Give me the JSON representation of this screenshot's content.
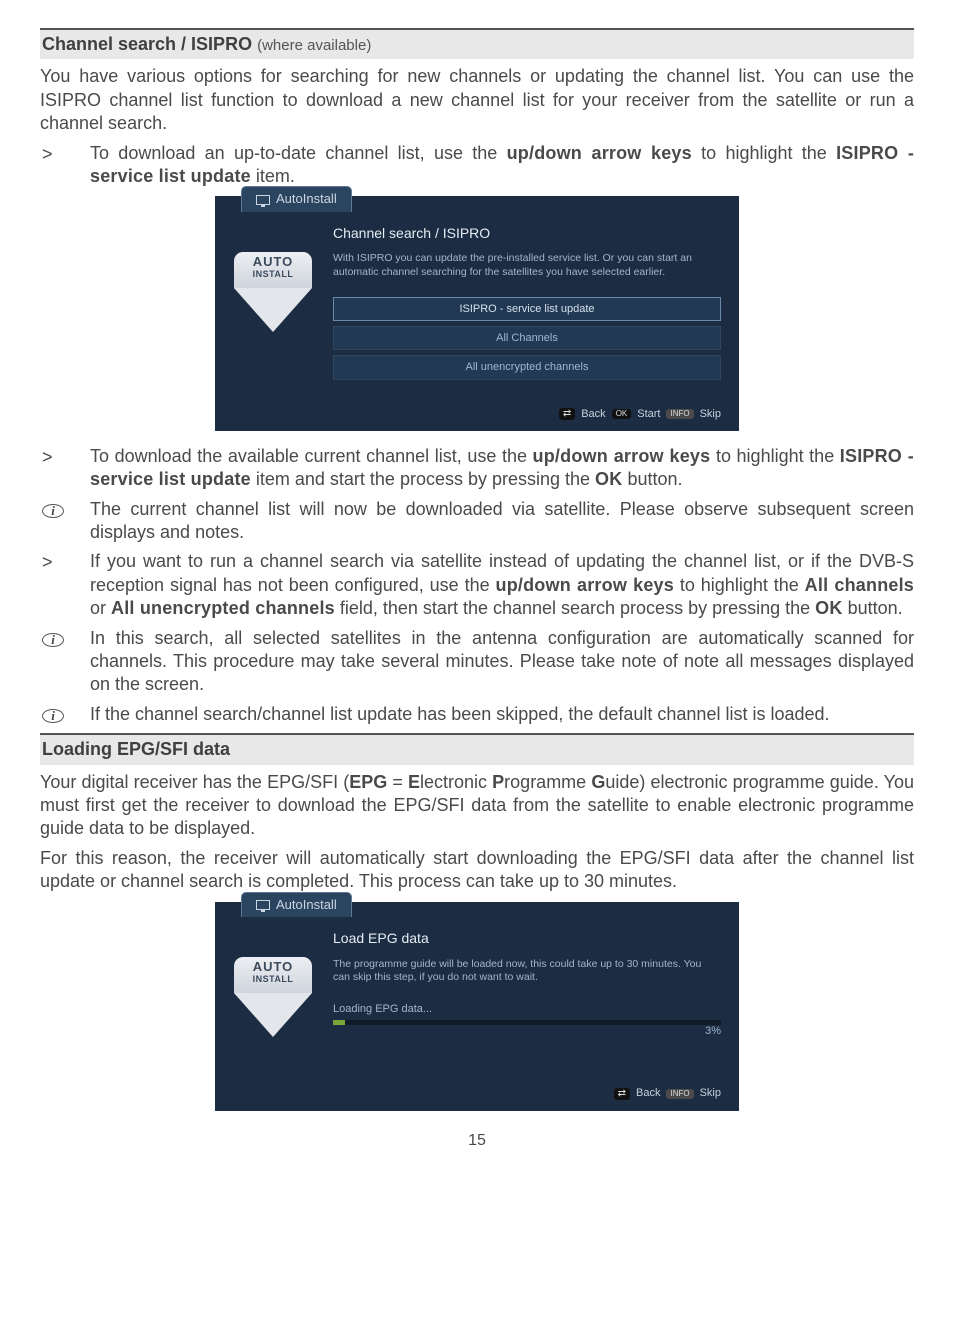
{
  "headings": {
    "section1_bold": "Channel search / ISIPRO",
    "section1_paren": "(where available)",
    "section2": "Loading EPG/SFI data"
  },
  "body": {
    "p1": "You have various options for searching for new channels or updating the channel list. You can use the ISIPRO channel list function to download a new channel list for your receiver from the satellite or run a channel search.",
    "b1a": "To download an up-to-date channel list, use the ",
    "b1_bold1": "up/down arrow keys",
    "b1b": " to highlight the ",
    "b1_bold2": "ISIPRO - service list update",
    "b1c": " item.",
    "b2a": "To download the available current channel list, use the ",
    "b2_bold1": "up/down arrow keys",
    "b2b": " to highlight the ",
    "b2_bold2": "ISIPRO - service list update",
    "b2c": " item and start the process by pressing the ",
    "b2_bold3": "OK",
    "b2d": " button.",
    "i1": "The current channel list will now be downloaded via satellite. Please observe subsequent screen displays and notes.",
    "b3a": "If you want to run a channel search via satellite instead of updating the channel list, or if the DVB-S reception signal has not been configured, use the ",
    "b3_bold1": "up/down arrow keys",
    "b3b": " to highlight the ",
    "b3_bold2": "All channels",
    "b3c": " or ",
    "b3_bold3": "All unencrypted channels",
    "b3d": " field, then start the channel search process by pressing the ",
    "b3_bold4": "OK",
    "b3e": " button.",
    "i2": "In this search, all selected satellites in the antenna configuration are automatically scanned for channels. This procedure may take several minutes. Please take note of note all messages displayed on the screen.",
    "i3": "If the channel search/channel list update has been skipped, the default channel list is loaded.",
    "p2a": "Your digital receiver has the EPG/SFI (",
    "p2_b1": "EPG",
    "p2b": " = ",
    "p2_b2": "E",
    "p2c": "lectronic ",
    "p2_b3": "P",
    "p2d": "rogramme ",
    "p2_b4": "G",
    "p2e": "uide) electronic programme guide. You must first get the receiver to download the EPG/SFI data from the satellite to enable electronic programme guide data to be displayed.",
    "p3": "For this reason, the receiver will automatically start downloading the EPG/SFI data after the channel list update or channel search is completed. This process can take up to 30 minutes."
  },
  "shot1": {
    "tab": "AutoInstall",
    "badge_l1": "AUTO",
    "badge_l2": "INSTALL",
    "title": "Channel search / ISIPRO",
    "desc": "With ISIPRO you can update the pre-installed service list. Or you can start an automatic channel searching for the satellites you have selected earlier.",
    "opt1": "ISIPRO - service list update",
    "opt2": "All Channels",
    "opt3": "All unencrypted channels",
    "foot_back": "Back",
    "foot_ok": "OK",
    "foot_start": "Start",
    "foot_info": "INFO",
    "foot_skip": "Skip"
  },
  "shot2": {
    "tab": "AutoInstall",
    "badge_l1": "AUTO",
    "badge_l2": "INSTALL",
    "title": "Load EPG data",
    "desc": "The programme guide will be loaded now, this could take up to 30 minutes. You can skip this step, if you do not want to wait.",
    "loading": "Loading EPG data...",
    "pct": "3%",
    "foot_back": "Back",
    "foot_info": "INFO",
    "foot_skip": "Skip"
  },
  "page_number": "15",
  "markers": {
    "chevron": ">"
  }
}
